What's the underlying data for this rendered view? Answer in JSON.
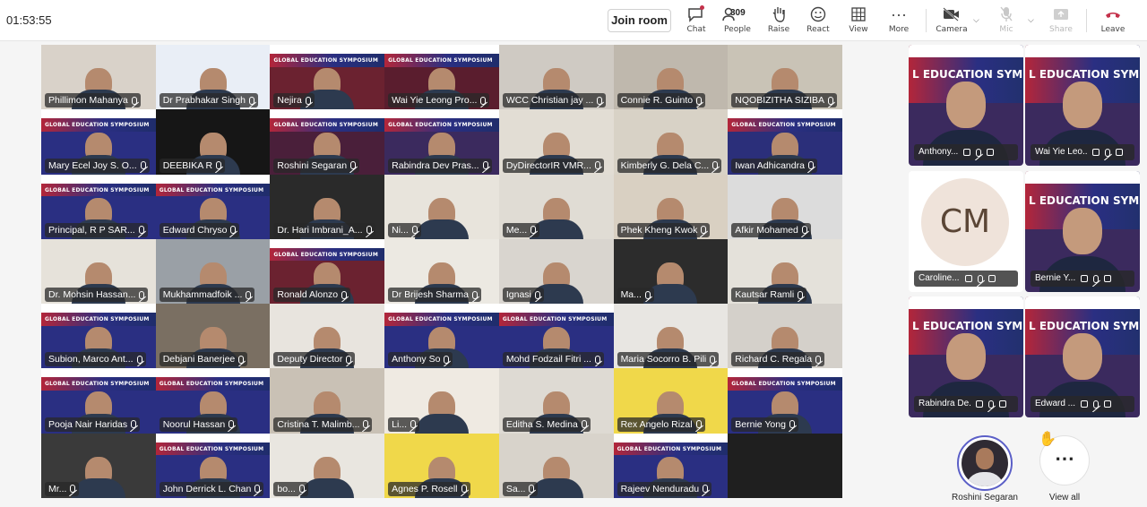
{
  "topbar": {
    "timer": "01:53:55",
    "join_label": "Join room",
    "chat_label": "Chat",
    "people_label": "People",
    "people_count": "309",
    "raise_label": "Raise",
    "react_label": "React",
    "view_label": "View",
    "more_label": "More",
    "camera_label": "Camera",
    "mic_label": "Mic",
    "share_label": "Share",
    "leave_label": "Leave"
  },
  "banner_text": "GLOBAL EDUCATION SYMPOSIUM",
  "side_banner_text": "L EDUCATION SYMPO",
  "grid": [
    {
      "name": "Phillimon Mahanya",
      "bg": "#d9d2c9",
      "banner": false
    },
    {
      "name": "Dr Prabhakar Singh",
      "bg": "#e9eef6",
      "banner": false
    },
    {
      "name": "Nejira",
      "bg": "#6b2230",
      "banner": true
    },
    {
      "name": "Wai Yie Leong Pro...",
      "bg": "#5a1d2e",
      "banner": true
    },
    {
      "name": "WCC Christian jay ...",
      "bg": "#cfcac3",
      "banner": false
    },
    {
      "name": "Connie R. Guinto",
      "bg": "#bfb8ad",
      "banner": false
    },
    {
      "name": "NQOBIZITHA SIZIBA",
      "bg": "#c9c3b6",
      "banner": false
    },
    {
      "name": "Mary Ecel Joy S. O...",
      "bg": "#2a2f82",
      "banner": true
    },
    {
      "name": "DEEBIKA R",
      "bg": "#161616",
      "banner": false
    },
    {
      "name": "Roshini Segaran",
      "bg": "#4a1f3a",
      "banner": true
    },
    {
      "name": "Rabindra Dev Pras...",
      "bg": "#3b2a5e",
      "banner": true
    },
    {
      "name": "DyDirectorIR VMR...",
      "bg": "#e2ddd4",
      "banner": false
    },
    {
      "name": "Kimberly G. Dela C...",
      "bg": "#d8d2c6",
      "banner": false
    },
    {
      "name": "Iwan Adhicandra",
      "bg": "#2b2f7a",
      "banner": true
    },
    {
      "name": "Principal, R P SAR...",
      "bg": "#2a2f82",
      "banner": true
    },
    {
      "name": "Edward Chryso",
      "bg": "#2a2f82",
      "banner": true
    },
    {
      "name": "Dr. Hari Imbrani_A...",
      "bg": "#2a2a2a",
      "banner": false
    },
    {
      "name": "Ni...",
      "bg": "#e8e4dc",
      "banner": false
    },
    {
      "name": "Me...",
      "bg": "#e0dcd4",
      "banner": false
    },
    {
      "name": "Phek Kheng Kwok",
      "bg": "#d9d0c2",
      "banner": false
    },
    {
      "name": "Afkir Mohamed",
      "bg": "#dcdcdc",
      "banner": false
    },
    {
      "name": "Dr. Mohsin Hassan...",
      "bg": "#e6e2da",
      "banner": false
    },
    {
      "name": "Mukhammadfoik ...",
      "bg": "#9aa0a6",
      "banner": false
    },
    {
      "name": "Ronald Alonzo",
      "bg": "#6b2230",
      "banner": true
    },
    {
      "name": "Dr Brijesh Sharma",
      "bg": "#ece9e2",
      "banner": false
    },
    {
      "name": "Ignasi",
      "bg": "#d9d5cf",
      "banner": false
    },
    {
      "name": "Ma...",
      "bg": "#2c2c2c",
      "banner": false
    },
    {
      "name": "Kautsar Ramli",
      "bg": "#e4e1da",
      "banner": false
    },
    {
      "name": "Subion, Marco Ant...",
      "bg": "#2a2f82",
      "banner": true
    },
    {
      "name": "Debjani Banerjee",
      "bg": "#7a6f62",
      "banner": false
    },
    {
      "name": "Deputy Director",
      "bg": "#e8e4de",
      "banner": false
    },
    {
      "name": "Anthony So",
      "bg": "#2a2f82",
      "banner": true
    },
    {
      "name": "Mohd Fodzail Fitri ...",
      "bg": "#2a2f82",
      "banner": true
    },
    {
      "name": "Maria Socorro B. Pili",
      "bg": "#e8e6e2",
      "banner": false
    },
    {
      "name": "Richard C. Regala",
      "bg": "#d4d0ca",
      "banner": false
    },
    {
      "name": "Pooja Nair Haridas",
      "bg": "#2a2f82",
      "banner": true
    },
    {
      "name": "Noorul Hassan",
      "bg": "#2a2f82",
      "banner": true
    },
    {
      "name": "Cristina T. Malimb...",
      "bg": "#c9c1b5",
      "banner": false
    },
    {
      "name": "Li...",
      "bg": "#efeae2",
      "banner": false
    },
    {
      "name": "Editha S. Medina",
      "bg": "#dedad3",
      "banner": false
    },
    {
      "name": "Rex Angelo Rizal",
      "bg": "#f0d84a",
      "banner": false
    },
    {
      "name": "Bernie Yong",
      "bg": "#2a2f82",
      "banner": true
    },
    {
      "name": "Mr...",
      "bg": "#3a3a3a",
      "banner": false
    },
    {
      "name": "John Derrick L. Chan",
      "bg": "#2a2f82",
      "banner": true
    },
    {
      "name": "bo...",
      "bg": "#e9e6e0",
      "banner": false
    },
    {
      "name": "Agnes P. Rosell",
      "bg": "#f0d84a",
      "banner": false
    },
    {
      "name": "Sa...",
      "bg": "#d8d3cb",
      "banner": false
    },
    {
      "name": "Rajeev Nenduradu",
      "bg": "#2a2f82",
      "banner": true
    },
    {
      "name": "",
      "bg": "#1f1f1f",
      "banner": false
    }
  ],
  "side": [
    {
      "name": "Anthony...",
      "type": "video"
    },
    {
      "name": "Wai Yie Leo...",
      "type": "video"
    },
    {
      "name": "Caroline...",
      "type": "avatar",
      "initials": "CM"
    },
    {
      "name": "Bernie Y...",
      "type": "video"
    },
    {
      "name": "Rabindra De...",
      "type": "video"
    },
    {
      "name": "Edward ...",
      "type": "video"
    }
  ],
  "bottom": {
    "presenter_name": "Roshini Segaran",
    "view_all_label": "View all",
    "view_all_glyph": "⋯",
    "raise_hand_glyph": "✋"
  },
  "colors": {
    "accent": "#5b5fc7",
    "leave": "#c4314b"
  }
}
